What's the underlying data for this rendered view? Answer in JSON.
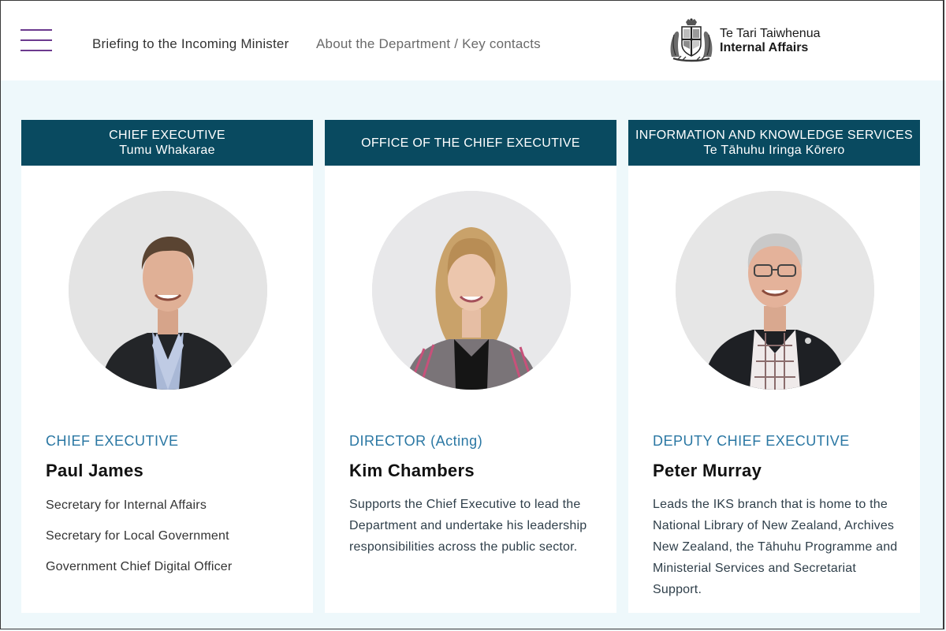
{
  "header": {
    "nav_primary": "Briefing to the Incoming Minister",
    "nav_secondary": "About the Department / Key contacts",
    "logo_line1": "Te Tari Taiwhenua",
    "logo_line2": "Internal Affairs"
  },
  "colors": {
    "accent": "#6c3a8e",
    "header_band": "#094a60",
    "role_text": "#2a77a3",
    "page_bg": "#eef8fb"
  },
  "cards": [
    {
      "header_line1": "CHIEF EXECUTIVE",
      "header_line2": "Tumu Whakarae",
      "role": "CHIEF EXECUTIVE",
      "name": "Paul James",
      "titles": [
        "Secretary for Internal Affairs",
        "Secretary for Local Government",
        "Government Chief Digital Officer"
      ]
    },
    {
      "header_line1": "OFFICE OF THE CHIEF EXECUTIVE",
      "role": "DIRECTOR (Acting)",
      "name": "Kim Chambers",
      "description": "Supports the Chief Executive to lead the Department and undertake his leadership responsibilities across the public sector."
    },
    {
      "header_line1": "INFORMATION AND KNOWLEDGE SERVICES",
      "header_line2": "Te Tāhuhu Iringa Kōrero",
      "role": "DEPUTY CHIEF EXECUTIVE",
      "name": "Peter Murray",
      "description": "Leads the IKS branch that is home to the National Library of New Zealand, Archives New Zealand, the Tāhuhu Programme and Ministerial Services and Secretariat Support."
    }
  ]
}
